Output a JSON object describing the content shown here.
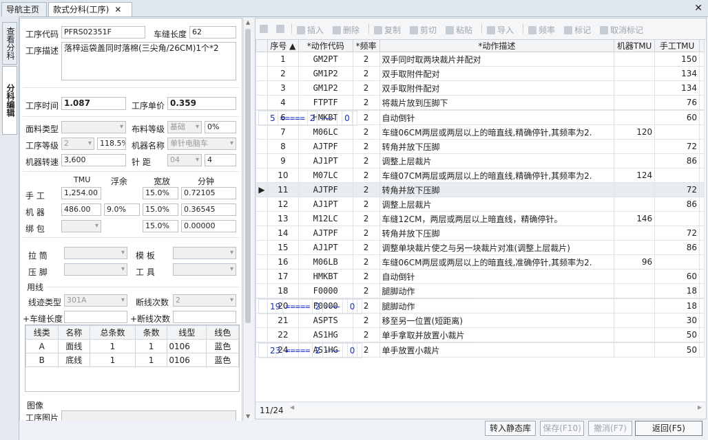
{
  "tabs": [
    {
      "label": "导航主页",
      "active": false
    },
    {
      "label": "款式分科(工序)",
      "active": true,
      "close": "✕"
    }
  ],
  "window_close": "✕",
  "side_tabs": [
    {
      "label": "查看分科",
      "active": false
    },
    {
      "label": "分科编辑",
      "active": true
    }
  ],
  "form": {
    "op_code_label": "工序代码",
    "op_code": "PFRS02351F",
    "seam_len_label": "车缝长度",
    "seam_len": "62",
    "op_desc_label": "工序描述",
    "op_desc": "落梓运袋盖同时落棉(三尖角/26CM)1个*2",
    "op_time_label": "工序时间",
    "op_time": "1.087",
    "op_price_label": "工序单价",
    "op_price": "0.359",
    "fabric_type_label": "面料类型",
    "fabric_type": "",
    "cloth_grade_label": "布料等级",
    "cloth_grade": "基础",
    "cloth_grade_pct": "0%",
    "op_grade_label": "工序等级",
    "op_grade": "2",
    "op_grade_pct": "118.5%",
    "machine_name_label": "机器名称",
    "machine_name": "单针电脑车",
    "machine_speed_label": "机器转速",
    "machine_speed": "3,600",
    "stitch_label": "针  距",
    "stitch": "04",
    "stitch_val": "4",
    "hdr_tmu": "TMU",
    "hdr_float": "浮余",
    "hdr_allow": "宽放",
    "hdr_min": "分钟",
    "manual_label": "手   工",
    "manual_tmu": "1,254.00",
    "manual_allow": "15.0%",
    "manual_min": "0.72105",
    "machine_label": "机   器",
    "machine_tmu": "486.00",
    "machine_float": "9.0%",
    "machine_allow": "15.0%",
    "machine_min": "0.36545",
    "bundle_label": "绑   包",
    "bundle_allow": "15.0%",
    "bundle_min": "0.00000",
    "pull_label": "拉   筒",
    "template_label": "模   板",
    "presser_label": "压   脚",
    "tool_label": "工   具",
    "thread_group": "用线",
    "trace_type_label": "线迹类型",
    "trace_type": "301A",
    "break_count_label": "断线次数",
    "break_count": "2",
    "add_seam_label": "+车缝长度",
    "add_break_label": "+断线次数",
    "image_group": "图像",
    "op_image_label": "工序图片"
  },
  "thread_table": {
    "headers": [
      "线类",
      "名称",
      "总条数",
      "条数",
      "线型",
      "线色"
    ],
    "rows": [
      [
        "A",
        "面线",
        "1",
        "1",
        "0106",
        "蓝色"
      ],
      [
        "B",
        "底线",
        "1",
        "1",
        "0106",
        "蓝色"
      ]
    ]
  },
  "toolbar": [
    {
      "label": "",
      "icon": "arrow-up-icon"
    },
    {
      "label": "",
      "icon": "arrow-down-icon"
    },
    {
      "label": "插入",
      "icon": "insert-icon"
    },
    {
      "label": "删除",
      "icon": "delete-icon"
    },
    {
      "label": "复制",
      "icon": "copy-icon"
    },
    {
      "label": "剪切",
      "icon": "cut-icon"
    },
    {
      "label": "粘贴",
      "icon": "paste-icon"
    },
    {
      "label": "导入",
      "icon": "import-icon"
    },
    {
      "label": "频率",
      "icon": "frequency-icon"
    },
    {
      "label": "标记",
      "icon": "mark-icon"
    },
    {
      "label": "取消标记",
      "icon": "unmark-icon"
    }
  ],
  "op_table": {
    "headers": [
      "序号 ▲",
      "*动作代码",
      "*频率",
      "*动作描述",
      "机器TMU",
      "手工TMU"
    ],
    "selected_row": 10,
    "rows": [
      [
        "1",
        "GM2PT",
        "2",
        "双手同时取两块裁片并配对",
        "",
        "150"
      ],
      [
        "2",
        "GM1P2",
        "2",
        "双手取附件配对",
        "",
        "134"
      ],
      [
        "3",
        "GM1P2",
        "2",
        "双手取附件配对",
        "",
        "134"
      ],
      [
        "4",
        "FTPTF",
        "2",
        "将裁片放到压脚下",
        "",
        "76"
      ],
      [
        "5",
        "=====",
        "2",
        "-----",
        "",
        "0"
      ],
      [
        "6",
        "HMKBT",
        "2",
        "自动倒针",
        "",
        "60"
      ],
      [
        "7",
        "M06LC",
        "2",
        "车缝06CM两层或两层以上的暗直线,精确停针,其频率为2.",
        "120",
        ""
      ],
      [
        "8",
        "AJTPF",
        "2",
        "转角并放下压脚",
        "",
        "72"
      ],
      [
        "9",
        "AJ1PT",
        "2",
        "调整上层裁片",
        "",
        "86"
      ],
      [
        "10",
        "M07LC",
        "2",
        "车缝07CM两层或两层以上的暗直线,精确停针,其频率为2.",
        "124",
        ""
      ],
      [
        "11",
        "AJTPF",
        "2",
        "转角并放下压脚",
        "",
        "72"
      ],
      [
        "12",
        "AJ1PT",
        "2",
        "调整上层裁片",
        "",
        "86"
      ],
      [
        "13",
        "M12LC",
        "2",
        "车缝12CM，两层或两层以上暗直线，精确停针。",
        "146",
        ""
      ],
      [
        "14",
        "AJTPF",
        "2",
        "转角并放下压脚",
        "",
        "72"
      ],
      [
        "15",
        "AJ1PT",
        "2",
        "调整单块裁片使之与另一块裁片对准(调整上层裁片)",
        "",
        "86"
      ],
      [
        "16",
        "M06LB",
        "2",
        "车缝06CM两层或两层以上的暗直线,准确停针,其频率为2.",
        "96",
        ""
      ],
      [
        "17",
        "HMKBT",
        "2",
        "自动倒针",
        "",
        "60"
      ],
      [
        "18",
        "F0000",
        "2",
        "腿脚动作",
        "",
        "18"
      ],
      [
        "19",
        "=====",
        "2",
        "-----",
        "",
        "0"
      ],
      [
        "20",
        "F0000",
        "2",
        "腿脚动作",
        "",
        "18"
      ],
      [
        "21",
        "ASPTS",
        "2",
        "移至另一位置(短距离)",
        "",
        "30"
      ],
      [
        "22",
        "AS1HG",
        "2",
        "单手拿取并放置小裁片",
        "",
        "50"
      ],
      [
        "23",
        "=====",
        "2",
        "-----",
        "",
        "0"
      ],
      [
        "24",
        "AS1HG",
        "2",
        "单手放置小裁片",
        "",
        "50"
      ]
    ]
  },
  "pager": "11/24",
  "buttons": {
    "to_static": "转入静态库",
    "save": "保存(F10)",
    "undo": "撤消(F7)",
    "back": "返回(F5)"
  }
}
